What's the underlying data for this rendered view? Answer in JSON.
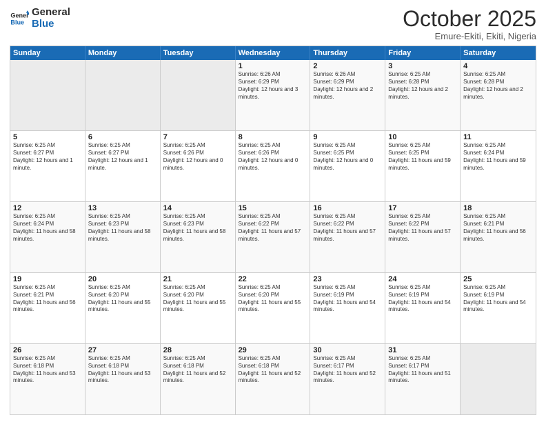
{
  "logo": {
    "text_general": "General",
    "text_blue": "Blue"
  },
  "header": {
    "month": "October 2025",
    "location": "Emure-Ekiti, Ekiti, Nigeria"
  },
  "days": [
    "Sunday",
    "Monday",
    "Tuesday",
    "Wednesday",
    "Thursday",
    "Friday",
    "Saturday"
  ],
  "weeks": [
    [
      {
        "date": "",
        "sunrise": "",
        "sunset": "",
        "daylight": ""
      },
      {
        "date": "",
        "sunrise": "",
        "sunset": "",
        "daylight": ""
      },
      {
        "date": "",
        "sunrise": "",
        "sunset": "",
        "daylight": ""
      },
      {
        "date": "1",
        "sunrise": "Sunrise: 6:26 AM",
        "sunset": "Sunset: 6:29 PM",
        "daylight": "Daylight: 12 hours and 3 minutes."
      },
      {
        "date": "2",
        "sunrise": "Sunrise: 6:26 AM",
        "sunset": "Sunset: 6:29 PM",
        "daylight": "Daylight: 12 hours and 2 minutes."
      },
      {
        "date": "3",
        "sunrise": "Sunrise: 6:25 AM",
        "sunset": "Sunset: 6:28 PM",
        "daylight": "Daylight: 12 hours and 2 minutes."
      },
      {
        "date": "4",
        "sunrise": "Sunrise: 6:25 AM",
        "sunset": "Sunset: 6:28 PM",
        "daylight": "Daylight: 12 hours and 2 minutes."
      }
    ],
    [
      {
        "date": "5",
        "sunrise": "Sunrise: 6:25 AM",
        "sunset": "Sunset: 6:27 PM",
        "daylight": "Daylight: 12 hours and 1 minute."
      },
      {
        "date": "6",
        "sunrise": "Sunrise: 6:25 AM",
        "sunset": "Sunset: 6:27 PM",
        "daylight": "Daylight: 12 hours and 1 minute."
      },
      {
        "date": "7",
        "sunrise": "Sunrise: 6:25 AM",
        "sunset": "Sunset: 6:26 PM",
        "daylight": "Daylight: 12 hours and 0 minutes."
      },
      {
        "date": "8",
        "sunrise": "Sunrise: 6:25 AM",
        "sunset": "Sunset: 6:26 PM",
        "daylight": "Daylight: 12 hours and 0 minutes."
      },
      {
        "date": "9",
        "sunrise": "Sunrise: 6:25 AM",
        "sunset": "Sunset: 6:25 PM",
        "daylight": "Daylight: 12 hours and 0 minutes."
      },
      {
        "date": "10",
        "sunrise": "Sunrise: 6:25 AM",
        "sunset": "Sunset: 6:25 PM",
        "daylight": "Daylight: 11 hours and 59 minutes."
      },
      {
        "date": "11",
        "sunrise": "Sunrise: 6:25 AM",
        "sunset": "Sunset: 6:24 PM",
        "daylight": "Daylight: 11 hours and 59 minutes."
      }
    ],
    [
      {
        "date": "12",
        "sunrise": "Sunrise: 6:25 AM",
        "sunset": "Sunset: 6:24 PM",
        "daylight": "Daylight: 11 hours and 58 minutes."
      },
      {
        "date": "13",
        "sunrise": "Sunrise: 6:25 AM",
        "sunset": "Sunset: 6:23 PM",
        "daylight": "Daylight: 11 hours and 58 minutes."
      },
      {
        "date": "14",
        "sunrise": "Sunrise: 6:25 AM",
        "sunset": "Sunset: 6:23 PM",
        "daylight": "Daylight: 11 hours and 58 minutes."
      },
      {
        "date": "15",
        "sunrise": "Sunrise: 6:25 AM",
        "sunset": "Sunset: 6:22 PM",
        "daylight": "Daylight: 11 hours and 57 minutes."
      },
      {
        "date": "16",
        "sunrise": "Sunrise: 6:25 AM",
        "sunset": "Sunset: 6:22 PM",
        "daylight": "Daylight: 11 hours and 57 minutes."
      },
      {
        "date": "17",
        "sunrise": "Sunrise: 6:25 AM",
        "sunset": "Sunset: 6:22 PM",
        "daylight": "Daylight: 11 hours and 57 minutes."
      },
      {
        "date": "18",
        "sunrise": "Sunrise: 6:25 AM",
        "sunset": "Sunset: 6:21 PM",
        "daylight": "Daylight: 11 hours and 56 minutes."
      }
    ],
    [
      {
        "date": "19",
        "sunrise": "Sunrise: 6:25 AM",
        "sunset": "Sunset: 6:21 PM",
        "daylight": "Daylight: 11 hours and 56 minutes."
      },
      {
        "date": "20",
        "sunrise": "Sunrise: 6:25 AM",
        "sunset": "Sunset: 6:20 PM",
        "daylight": "Daylight: 11 hours and 55 minutes."
      },
      {
        "date": "21",
        "sunrise": "Sunrise: 6:25 AM",
        "sunset": "Sunset: 6:20 PM",
        "daylight": "Daylight: 11 hours and 55 minutes."
      },
      {
        "date": "22",
        "sunrise": "Sunrise: 6:25 AM",
        "sunset": "Sunset: 6:20 PM",
        "daylight": "Daylight: 11 hours and 55 minutes."
      },
      {
        "date": "23",
        "sunrise": "Sunrise: 6:25 AM",
        "sunset": "Sunset: 6:19 PM",
        "daylight": "Daylight: 11 hours and 54 minutes."
      },
      {
        "date": "24",
        "sunrise": "Sunrise: 6:25 AM",
        "sunset": "Sunset: 6:19 PM",
        "daylight": "Daylight: 11 hours and 54 minutes."
      },
      {
        "date": "25",
        "sunrise": "Sunrise: 6:25 AM",
        "sunset": "Sunset: 6:19 PM",
        "daylight": "Daylight: 11 hours and 54 minutes."
      }
    ],
    [
      {
        "date": "26",
        "sunrise": "Sunrise: 6:25 AM",
        "sunset": "Sunset: 6:18 PM",
        "daylight": "Daylight: 11 hours and 53 minutes."
      },
      {
        "date": "27",
        "sunrise": "Sunrise: 6:25 AM",
        "sunset": "Sunset: 6:18 PM",
        "daylight": "Daylight: 11 hours and 53 minutes."
      },
      {
        "date": "28",
        "sunrise": "Sunrise: 6:25 AM",
        "sunset": "Sunset: 6:18 PM",
        "daylight": "Daylight: 11 hours and 52 minutes."
      },
      {
        "date": "29",
        "sunrise": "Sunrise: 6:25 AM",
        "sunset": "Sunset: 6:18 PM",
        "daylight": "Daylight: 11 hours and 52 minutes."
      },
      {
        "date": "30",
        "sunrise": "Sunrise: 6:25 AM",
        "sunset": "Sunset: 6:17 PM",
        "daylight": "Daylight: 11 hours and 52 minutes."
      },
      {
        "date": "31",
        "sunrise": "Sunrise: 6:25 AM",
        "sunset": "Sunset: 6:17 PM",
        "daylight": "Daylight: 11 hours and 51 minutes."
      },
      {
        "date": "",
        "sunrise": "",
        "sunset": "",
        "daylight": ""
      }
    ]
  ]
}
